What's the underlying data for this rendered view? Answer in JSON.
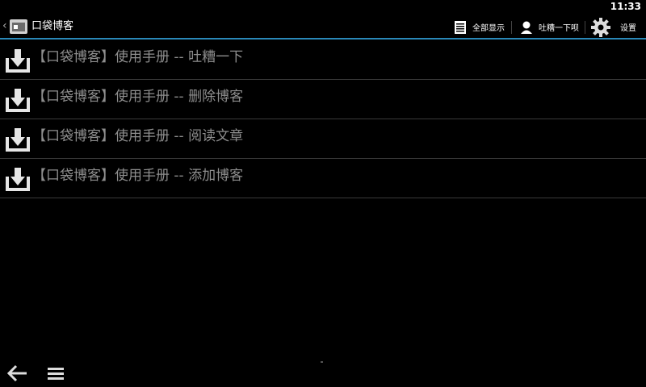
{
  "status_bar": {
    "time": "11:33"
  },
  "action_bar": {
    "title": "口袋博客",
    "actions": [
      {
        "label": "全部显示",
        "icon": "list-icon"
      },
      {
        "label": "吐糟一下呗",
        "icon": "person-icon"
      },
      {
        "label": "设置",
        "icon": "gear-icon"
      }
    ]
  },
  "list": {
    "items": [
      {
        "title": "【口袋博客】使用手册 -- 吐糟一下",
        "icon": "download-icon"
      },
      {
        "title": "【口袋博客】使用手册 -- 删除博客",
        "icon": "download-icon"
      },
      {
        "title": "【口袋博客】使用手册 -- 阅读文章",
        "icon": "download-icon"
      },
      {
        "title": "【口袋博客】使用手册 -- 添加博客",
        "icon": "download-icon"
      }
    ]
  },
  "colors": {
    "accent": "#2a88b8",
    "item_text": "#8e8e8e",
    "divider": "#3a3a3a"
  }
}
